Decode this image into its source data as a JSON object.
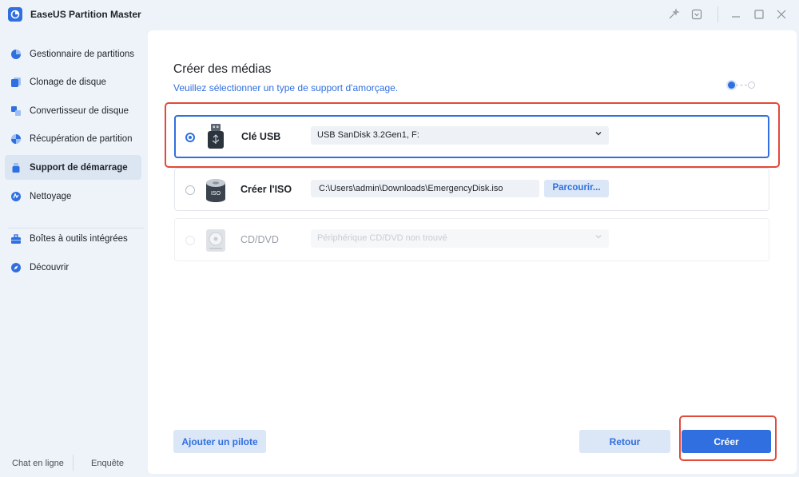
{
  "window": {
    "title": "EaseUS Partition Master",
    "controls": [
      "sparkle-icon",
      "feedback-icon",
      "minimize-icon",
      "maximize-icon",
      "close-icon"
    ]
  },
  "sidebar": {
    "items": [
      {
        "label": "Gestionnaire de partitions",
        "icon": "pie-chart-icon",
        "active": false
      },
      {
        "label": "Clonage de disque",
        "icon": "clone-icon",
        "active": false
      },
      {
        "label": "Convertisseur de disque",
        "icon": "convert-icon",
        "active": false
      },
      {
        "label": "Récupération de partition",
        "icon": "recovery-icon",
        "active": false
      },
      {
        "label": "Support de démarrage",
        "icon": "usb-icon",
        "active": true
      },
      {
        "label": "Nettoyage",
        "icon": "clean-icon",
        "active": false
      },
      {
        "label": "Boîtes à outils intégrées",
        "icon": "toolbox-icon",
        "active": false
      },
      {
        "label": "Découvrir",
        "icon": "compass-icon",
        "active": false
      }
    ],
    "footer": {
      "chat": "Chat en ligne",
      "survey": "Enquête"
    }
  },
  "main": {
    "title": "Créer des médias",
    "subtitle": "Veuillez sélectionner un type de support d'amorçage.",
    "steps": {
      "current": 1,
      "total": 2
    },
    "options": {
      "usb": {
        "label": "Clé USB",
        "selected_device": "USB SanDisk 3.2Gen1, F:"
      },
      "iso": {
        "label": "Créer l'ISO",
        "path": "C:\\Users\\admin\\Downloads\\EmergencyDisk.iso",
        "browse_label": "Parcourir...",
        "badge": "ISO"
      },
      "cd": {
        "label": "CD/DVD",
        "placeholder": "Périphérique CD/DVD non trouvé"
      }
    },
    "buttons": {
      "add_driver": "Ajouter un pilote",
      "back": "Retour",
      "create": "Créer"
    }
  },
  "colors": {
    "accent": "#2f6fe0",
    "highlight": "#e2493a",
    "background": "#eef3f9"
  }
}
